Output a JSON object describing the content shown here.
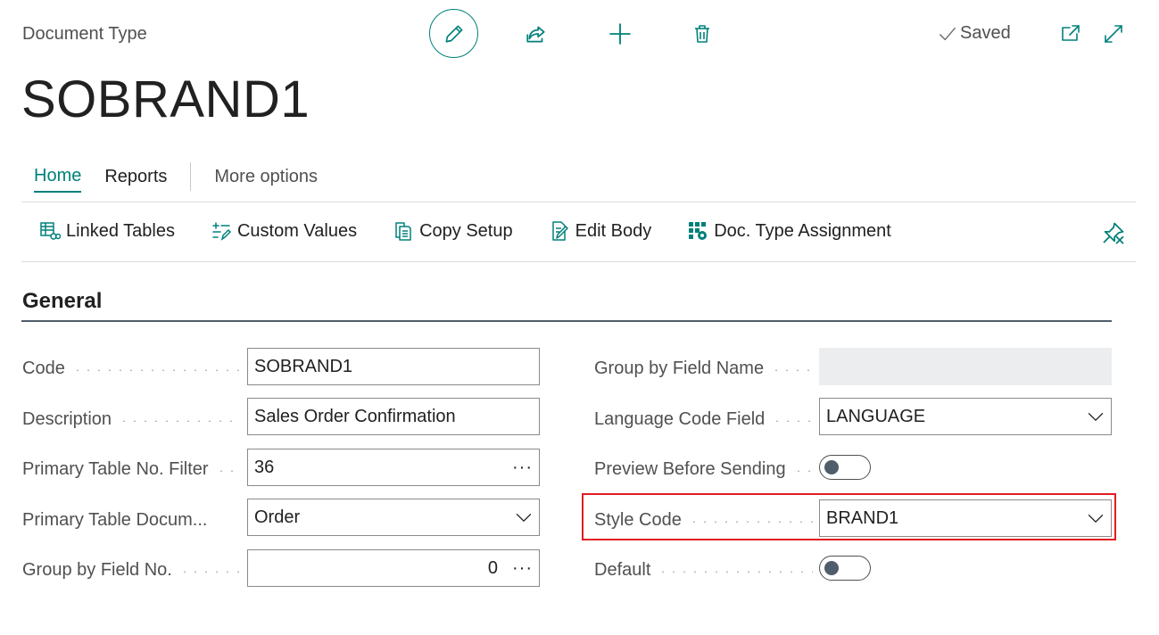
{
  "header": {
    "caption": "Document Type",
    "title": "SOBRAND1",
    "saved_label": "Saved",
    "icons": [
      "edit-pencil-icon",
      "share-icon",
      "plus-icon",
      "trash-icon",
      "check-icon",
      "open-new-window-icon",
      "expand-icon"
    ]
  },
  "colors": {
    "accent": "#00807a",
    "highlight": "#e11b22",
    "section_line": "#505d6b"
  },
  "tabs": [
    {
      "label": "Home",
      "active": true
    },
    {
      "label": "Reports",
      "active": false
    },
    {
      "label": "More options",
      "active": false
    }
  ],
  "actions": [
    {
      "label": "Linked Tables",
      "icon": "linked-tables-icon"
    },
    {
      "label": "Custom Values",
      "icon": "custom-values-icon"
    },
    {
      "label": "Copy Setup",
      "icon": "copy-icon"
    },
    {
      "label": "Edit Body",
      "icon": "edit-document-icon"
    },
    {
      "label": "Doc. Type Assignment",
      "icon": "assignment-grid-icon"
    }
  ],
  "section": {
    "title": "General"
  },
  "left_fields": {
    "code": {
      "label": "Code",
      "value": "SOBRAND1"
    },
    "description": {
      "label": "Description",
      "value": "Sales Order Confirmation"
    },
    "primary_table_filter": {
      "label": "Primary Table No. Filter",
      "value": "36",
      "lookup": "···"
    },
    "primary_table_document": {
      "label": "Primary Table Docum...",
      "value": "Order"
    },
    "group_by_field_no": {
      "label": "Group by Field No.",
      "value": "0",
      "lookup": "···"
    }
  },
  "right_fields": {
    "group_by_field_name": {
      "label": "Group by Field Name",
      "value": ""
    },
    "language_code_field": {
      "label": "Language Code Field",
      "value": "LANGUAGE"
    },
    "preview_before_sending": {
      "label": "Preview Before Sending",
      "checked": false
    },
    "style_code": {
      "label": "Style Code",
      "value": "BRAND1"
    },
    "default": {
      "label": "Default",
      "checked": false
    }
  }
}
